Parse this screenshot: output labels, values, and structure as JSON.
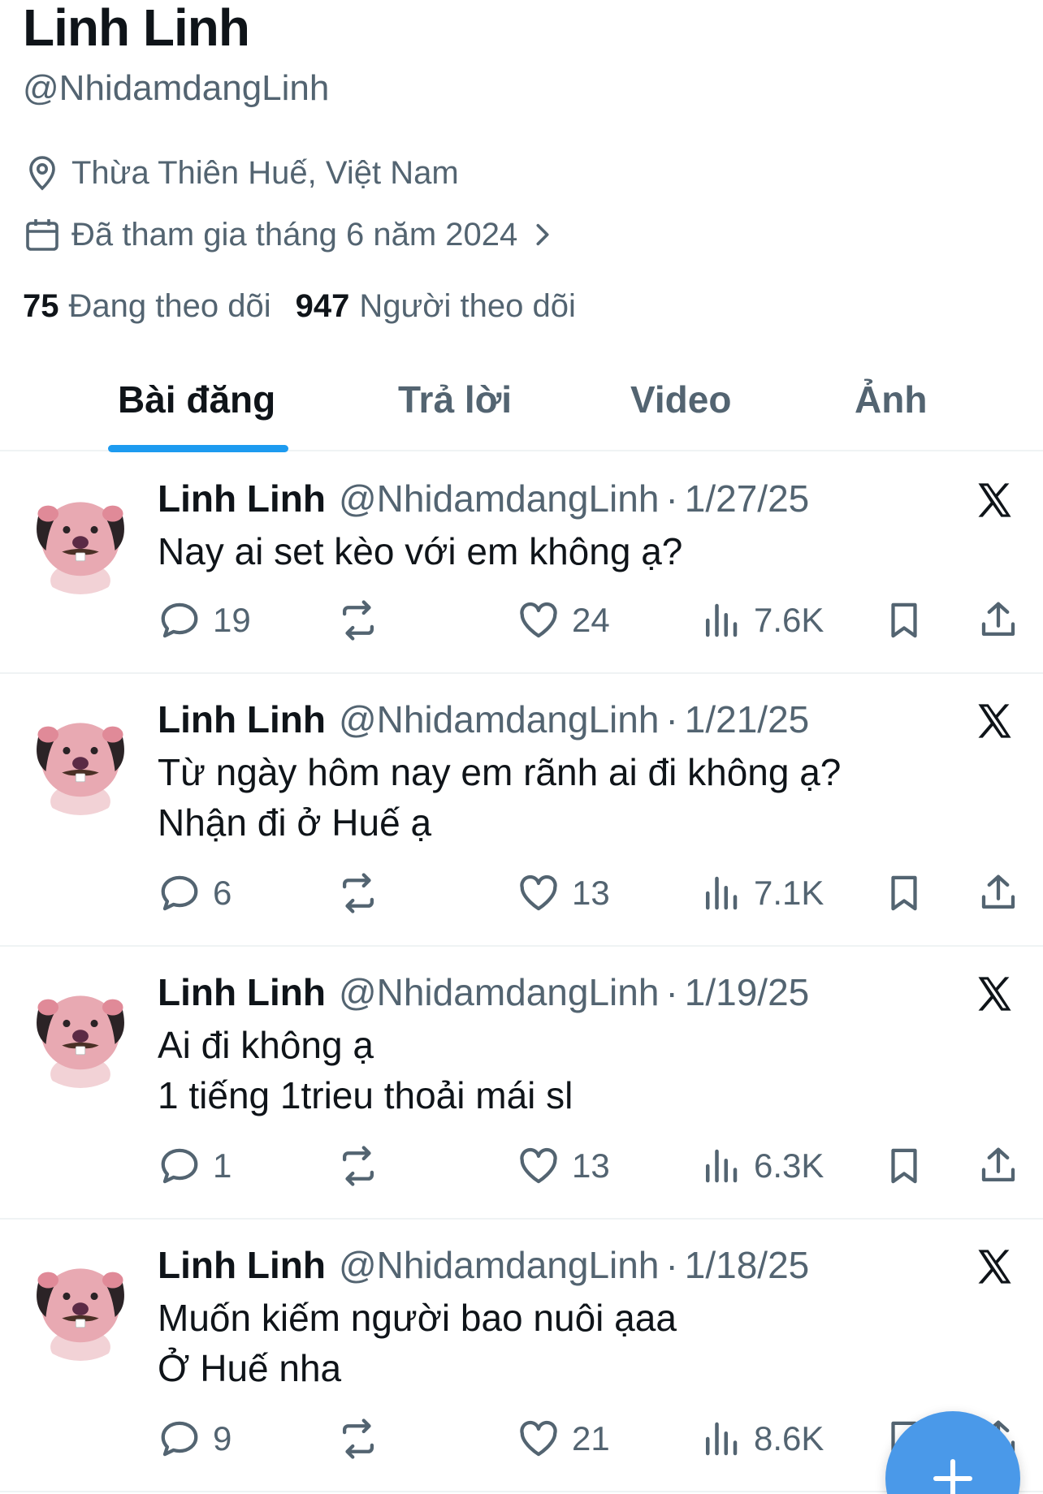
{
  "profile": {
    "display_name": "Linh Linh",
    "handle": "@NhidamdangLinh",
    "location": "Thừa Thiên Huế, Việt Nam",
    "joined": "Đã tham gia tháng 6 năm 2024",
    "following_count": "75",
    "following_label": "Đang theo dõi",
    "followers_count": "947",
    "followers_label": "Người theo dõi"
  },
  "tabs": [
    {
      "label": "Bài đăng",
      "active": true
    },
    {
      "label": "Trả lời",
      "active": false
    },
    {
      "label": "Video",
      "active": false
    },
    {
      "label": "Ảnh",
      "active": false
    }
  ],
  "posts": [
    {
      "name": "Linh Linh",
      "handle": "@NhidamdangLinh",
      "separator": "·",
      "date": "1/27/25",
      "text": "Nay ai set kèo với em không ạ?",
      "replies": "19",
      "likes": "24",
      "views": "7.6K"
    },
    {
      "name": "Linh Linh",
      "handle": "@NhidamdangLinh",
      "separator": "·",
      "date": "1/21/25",
      "text": "Từ ngày hôm nay em rãnh ai đi không ạ?\nNhận đi ở Huế ạ",
      "replies": "6",
      "likes": "13",
      "views": "7.1K"
    },
    {
      "name": "Linh Linh",
      "handle": "@NhidamdangLinh",
      "separator": "·",
      "date": "1/19/25",
      "text": "Ai đi không ạ\n1 tiếng 1trieu thoải mái sl",
      "replies": "1",
      "likes": "13",
      "views": "6.3K"
    },
    {
      "name": "Linh Linh",
      "handle": "@NhidamdangLinh",
      "separator": "·",
      "date": "1/18/25",
      "text": "Muốn kiếm người bao nuôi ạaa\nỞ Huế nha",
      "replies": "9",
      "likes": "21",
      "views": "8.6K"
    }
  ],
  "icons": {
    "location": "location-pin-icon",
    "calendar": "calendar-icon",
    "chevron": "chevron-right-icon",
    "reply": "reply-bubble-icon",
    "repost": "repost-icon",
    "like": "heart-icon",
    "views": "views-bar-icon",
    "bookmark": "bookmark-icon",
    "share": "share-icon",
    "grok": "x-logo-icon",
    "compose": "plus-icon"
  },
  "colors": {
    "text_primary": "#0f1419",
    "text_secondary": "#536471",
    "accent": "#1d9bf0",
    "fab": "#4a99e9",
    "divider": "#eff3f4"
  }
}
